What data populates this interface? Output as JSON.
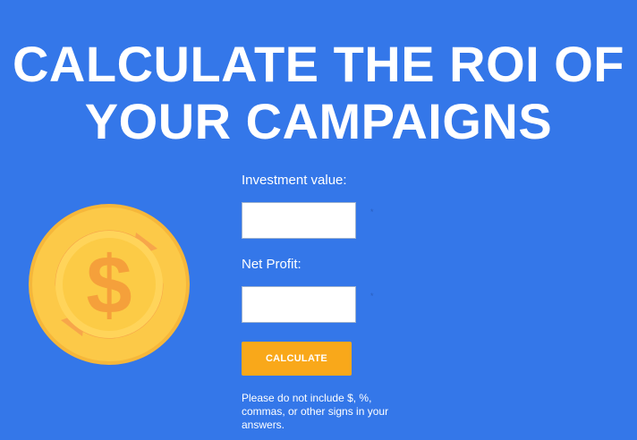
{
  "page": {
    "headline_line1": "CALCULATE THE ROI OF",
    "headline_line2": "YOUR CAMPAIGNS"
  },
  "illustration": {
    "icon": "dollar-coin-icon",
    "colors": {
      "outer": "#f7c13a",
      "ring": "#ffd866",
      "inner": "#fccf46",
      "symbol": "#f5a03b"
    }
  },
  "form": {
    "investment_label": "Investment value:",
    "investment_value": "",
    "profit_label": "Net Profit:",
    "profit_value": "",
    "required_mark": "*",
    "calculate_label": "CALCULATE",
    "note": "Please do not include $, %, commas, or other signs in your answers."
  },
  "colors": {
    "background": "#3477e9",
    "accent_button": "#f9a81a",
    "text": "#ffffff"
  }
}
